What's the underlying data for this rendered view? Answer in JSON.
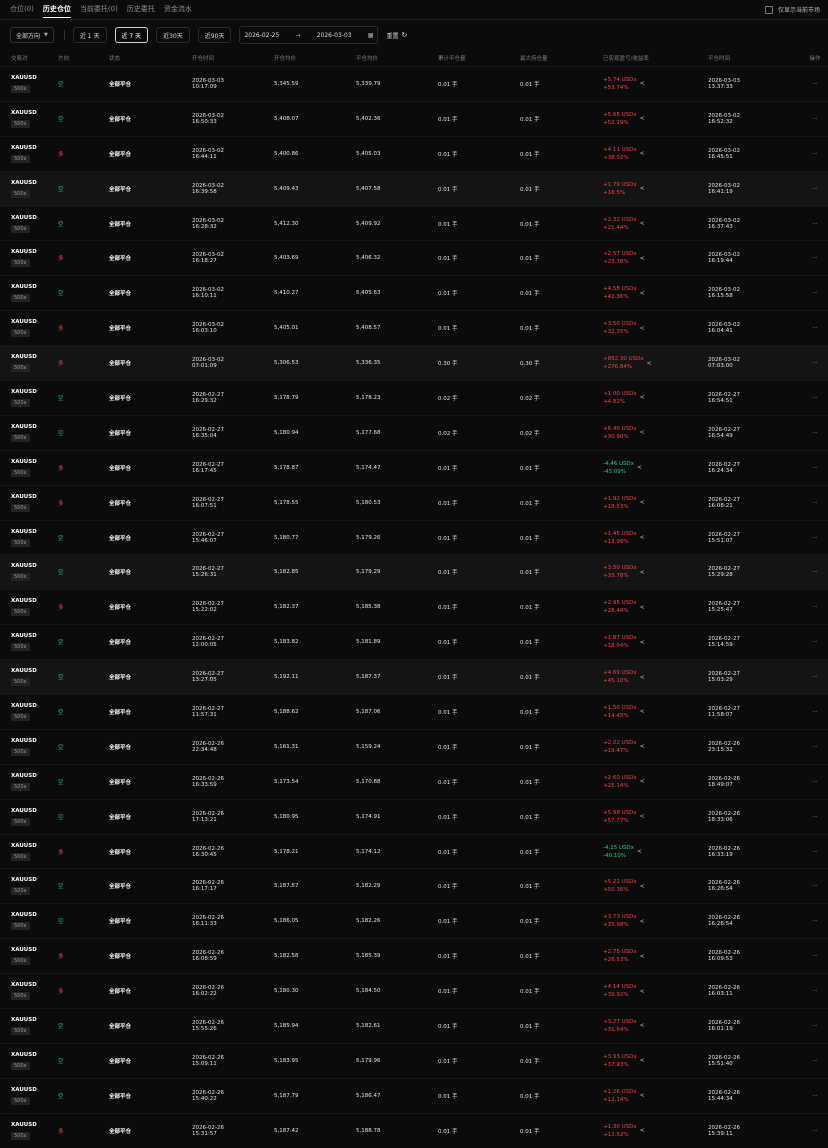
{
  "tabs": [
    {
      "label": "仓位(0)",
      "active": false
    },
    {
      "label": "历史仓位",
      "active": true
    },
    {
      "label": "当前委托(0)",
      "active": false
    },
    {
      "label": "历史委托",
      "active": false
    },
    {
      "label": "资金流水",
      "active": false
    }
  ],
  "market_toggle": {
    "label": "仅显示当前市场",
    "checked": false
  },
  "filters": {
    "direction": "全部方向",
    "periods": [
      {
        "label": "近 1 天",
        "active": false
      },
      {
        "label": "近 7 天",
        "active": true
      },
      {
        "label": "近30天",
        "active": false
      },
      {
        "label": "近90天",
        "active": false
      }
    ],
    "start_date": "2026-02-25",
    "end_date": "2026-03-03",
    "reset": "重置"
  },
  "columns": [
    "交易对",
    "方向",
    "状态",
    "开仓时间",
    "开仓均价",
    "平仓均价",
    "累计平仓量",
    "最大持仓量",
    "已实现盈亏/收益率",
    "平仓时间",
    "操作"
  ],
  "rows": [
    {
      "pair": "XAUUSD",
      "lev": "500x",
      "dir": "空",
      "status": "全部平仓",
      "open_date": "2026-03-03",
      "open_time": "10:17:09",
      "open_price": "5,345.59",
      "close_price": "5,339.79",
      "closed_qty": "0.01 手",
      "max_qty": "0.01 手",
      "pnl": "+5.74 USDx",
      "roi": "+53.74%",
      "close_date": "2026-03-03",
      "close_time": "13:37:33"
    },
    {
      "pair": "XAUUSD",
      "lev": "500x",
      "dir": "空",
      "status": "全部平仓",
      "open_date": "2026-03-02",
      "open_time": "16:50:33",
      "open_price": "5,408.07",
      "close_price": "5,402.36",
      "closed_qty": "0.01 手",
      "max_qty": "0.01 手",
      "pnl": "+5.65 USDx",
      "roi": "+52.29%",
      "close_date": "2026-03-02",
      "close_time": "16:52:32"
    },
    {
      "pair": "XAUUSD",
      "lev": "500x",
      "dir": "多",
      "status": "全部平仓",
      "open_date": "2026-03-02",
      "open_time": "16:44:11",
      "open_price": "5,400.86",
      "close_price": "5,405.03",
      "closed_qty": "0.01 手",
      "max_qty": "0.01 手",
      "pnl": "+4.11 USDx",
      "roi": "+38.02%",
      "close_date": "2026-03-02",
      "close_time": "16:45:51"
    },
    {
      "pair": "XAUUSD",
      "lev": "500x",
      "dir": "空",
      "status": "全部平仓",
      "open_date": "2026-03-02",
      "open_time": "16:39:58",
      "open_price": "5,409.43",
      "close_price": "5,407.58",
      "closed_qty": "0.01 手",
      "max_qty": "0.01 手",
      "pnl": "+1.79 USDx",
      "roi": "+16.5%",
      "close_date": "2026-03-02",
      "close_time": "16:41:19"
    },
    {
      "pair": "XAUUSD",
      "lev": "500x",
      "dir": "空",
      "status": "全部平仓",
      "open_date": "2026-03-02",
      "open_time": "16:28:32",
      "open_price": "5,412.30",
      "close_price": "5,409.92",
      "closed_qty": "0.01 手",
      "max_qty": "0.01 手",
      "pnl": "+2.32 USDx",
      "roi": "+21.44%",
      "close_date": "2026-03-02",
      "close_time": "16:37:43"
    },
    {
      "pair": "XAUUSD",
      "lev": "500x",
      "dir": "多",
      "status": "全部平仓",
      "open_date": "2026-03-02",
      "open_time": "16:18:27",
      "open_price": "5,403.69",
      "close_price": "5,406.32",
      "closed_qty": "0.01 手",
      "max_qty": "0.01 手",
      "pnl": "+2.57 USDx",
      "roi": "+23.76%",
      "close_date": "2026-03-02",
      "close_time": "16:19:44"
    },
    {
      "pair": "XAUUSD",
      "lev": "500x",
      "dir": "空",
      "status": "全部平仓",
      "open_date": "2026-03-02",
      "open_time": "16:10:11",
      "open_price": "5,410.27",
      "close_price": "5,405.63",
      "closed_qty": "0.01 手",
      "max_qty": "0.01 手",
      "pnl": "+4.58 USDx",
      "roi": "+42.36%",
      "close_date": "2026-03-02",
      "close_time": "16:15:58"
    },
    {
      "pair": "XAUUSD",
      "lev": "500x",
      "dir": "多",
      "status": "全部平仓",
      "open_date": "2026-03-02",
      "open_time": "16:03:10",
      "open_price": "5,405.01",
      "close_price": "5,408.57",
      "closed_qty": "0.01 手",
      "max_qty": "0.01 手",
      "pnl": "+3.50 USDx",
      "roi": "+32.35%",
      "close_date": "2026-03-02",
      "close_time": "16:04:41"
    },
    {
      "pair": "XAUUSD",
      "lev": "500x",
      "dir": "多",
      "status": "全部平仓",
      "open_date": "2026-03-02",
      "open_time": "07:01:09",
      "open_price": "5,306.53",
      "close_price": "5,336.35",
      "closed_qty": "0.30 手",
      "max_qty": "0.30 手",
      "pnl": "+892.30 USDx",
      "roi": "+276.84%",
      "close_date": "2026-03-02",
      "close_time": "07:03:00"
    },
    {
      "pair": "XAUUSD",
      "lev": "500x",
      "dir": "空",
      "status": "全部平仓",
      "open_date": "2026-02-27",
      "open_time": "16:29:32",
      "open_price": "5,178.79",
      "close_price": "5,178.23",
      "closed_qty": "0.02 手",
      "max_qty": "0.02 手",
      "pnl": "+1.00 USDx",
      "roi": "+4.82%",
      "close_date": "2026-02-27",
      "close_time": "16:54:51"
    },
    {
      "pair": "XAUUSD",
      "lev": "500x",
      "dir": "空",
      "status": "全部平仓",
      "open_date": "2026-02-27",
      "open_time": "16:35:04",
      "open_price": "5,180.94",
      "close_price": "5,177.68",
      "closed_qty": "0.02 手",
      "max_qty": "0.02 手",
      "pnl": "+6.40 USDx",
      "roi": "+30.90%",
      "close_date": "2026-02-27",
      "close_time": "16:54:49"
    },
    {
      "pair": "XAUUSD",
      "lev": "500x",
      "dir": "多",
      "status": "全部平仓",
      "open_date": "2026-02-27",
      "open_time": "16:17:45",
      "open_price": "5,178.87",
      "close_price": "5,174.47",
      "closed_qty": "0.01 手",
      "max_qty": "0.01 手",
      "pnl": "-4.46 USDx",
      "roi": "-43.09%",
      "close_date": "2026-02-27",
      "close_time": "16:24:34"
    },
    {
      "pair": "XAUUSD",
      "lev": "500x",
      "dir": "多",
      "status": "全部平仓",
      "open_date": "2026-02-27",
      "open_time": "16:07:51",
      "open_price": "5,178.55",
      "close_price": "5,180.53",
      "closed_qty": "0.01 手",
      "max_qty": "0.01 手",
      "pnl": "+1.92 USDx",
      "roi": "+18.53%",
      "close_date": "2026-02-27",
      "close_time": "16:08:21"
    },
    {
      "pair": "XAUUSD",
      "lev": "500x",
      "dir": "空",
      "status": "全部平仓",
      "open_date": "2026-02-27",
      "open_time": "15:46:07",
      "open_price": "5,180.77",
      "close_price": "5,179.26",
      "closed_qty": "0.01 手",
      "max_qty": "0.01 手",
      "pnl": "+1.45 USDx",
      "roi": "+13.99%",
      "close_date": "2026-02-27",
      "close_time": "15:51:07"
    },
    {
      "pair": "XAUUSD",
      "lev": "500x",
      "dir": "空",
      "status": "全部平仓",
      "open_date": "2026-02-27",
      "open_time": "15:26:31",
      "open_price": "5,182.85",
      "close_price": "5,179.29",
      "closed_qty": "0.01 手",
      "max_qty": "0.01 手",
      "pnl": "+3.50 USDx",
      "roi": "+33.78%",
      "close_date": "2026-02-27",
      "close_time": "15:29:28"
    },
    {
      "pair": "XAUUSD",
      "lev": "500x",
      "dir": "多",
      "status": "全部平仓",
      "open_date": "2026-02-27",
      "open_time": "15:22:02",
      "open_price": "5,182.37",
      "close_price": "5,185.38",
      "closed_qty": "0.01 手",
      "max_qty": "0.01 手",
      "pnl": "+2.95 USDx",
      "roi": "+28.44%",
      "close_date": "2026-02-27",
      "close_time": "15:25:47"
    },
    {
      "pair": "XAUUSD",
      "lev": "500x",
      "dir": "空",
      "status": "全部平仓",
      "open_date": "2026-02-27",
      "open_time": "12:00:05",
      "open_price": "5,183.82",
      "close_price": "5,181.89",
      "closed_qty": "0.01 手",
      "max_qty": "0.01 手",
      "pnl": "+1.87 USDx",
      "roi": "+18.04%",
      "close_date": "2026-02-27",
      "close_time": "15:14:59"
    },
    {
      "pair": "XAUUSD",
      "lev": "500x",
      "dir": "空",
      "status": "全部平仓",
      "open_date": "2026-02-27",
      "open_time": "13:27:05",
      "open_price": "5,192.11",
      "close_price": "5,187.37",
      "closed_qty": "0.01 手",
      "max_qty": "0.01 手",
      "pnl": "+4.69 USDx",
      "roi": "+45.10%",
      "close_date": "2026-02-27",
      "close_time": "15:03:29"
    },
    {
      "pair": "XAUUSD",
      "lev": "500x",
      "dir": "空",
      "status": "全部平仓",
      "open_date": "2026-02-27",
      "open_time": "11:57:31",
      "open_price": "5,188.62",
      "close_price": "5,187.06",
      "closed_qty": "0.01 手",
      "max_qty": "0.01 手",
      "pnl": "+1.50 USDx",
      "roi": "+14.45%",
      "close_date": "2026-02-27",
      "close_time": "11:58:07"
    },
    {
      "pair": "XAUUSD",
      "lev": "500x",
      "dir": "空",
      "status": "全部平仓",
      "open_date": "2026-02-26",
      "open_time": "22:34:48",
      "open_price": "5,161.31",
      "close_price": "5,159.24",
      "closed_qty": "0.01 手",
      "max_qty": "0.01 手",
      "pnl": "+2.02 USDx",
      "roi": "+19.47%",
      "close_date": "2026-02-26",
      "close_time": "23:15:32"
    },
    {
      "pair": "XAUUSD",
      "lev": "500x",
      "dir": "空",
      "status": "全部平仓",
      "open_date": "2026-02-26",
      "open_time": "16:33:59",
      "open_price": "5,173.54",
      "close_price": "5,170.88",
      "closed_qty": "0.01 手",
      "max_qty": "0.01 手",
      "pnl": "+2.60 USDx",
      "roi": "+25.14%",
      "close_date": "2026-02-26",
      "close_time": "18:49:07"
    },
    {
      "pair": "XAUUSD",
      "lev": "500x",
      "dir": "空",
      "status": "全部平仓",
      "open_date": "2026-02-26",
      "open_time": "17:13:21",
      "open_price": "5,180.95",
      "close_price": "5,174.91",
      "closed_qty": "0.01 手",
      "max_qty": "0.01 手",
      "pnl": "+5.98 USDx",
      "roi": "+57.77%",
      "close_date": "2026-02-26",
      "close_time": "18:33:06"
    },
    {
      "pair": "XAUUSD",
      "lev": "500x",
      "dir": "多",
      "status": "全部平仓",
      "open_date": "2026-02-26",
      "open_time": "16:30:45",
      "open_price": "5,178.21",
      "close_price": "5,174.12",
      "closed_qty": "0.01 手",
      "max_qty": "0.01 手",
      "pnl": "-4.15 USDx",
      "roi": "-40.10%",
      "close_date": "2026-02-26",
      "close_time": "16:33:19"
    },
    {
      "pair": "XAUUSD",
      "lev": "500x",
      "dir": "空",
      "status": "全部平仓",
      "open_date": "2026-02-26",
      "open_time": "16:17:17",
      "open_price": "5,187.57",
      "close_price": "5,182.29",
      "closed_qty": "0.01 手",
      "max_qty": "0.01 手",
      "pnl": "+5.22 USDx",
      "roi": "+50.36%",
      "close_date": "2026-02-26",
      "close_time": "16:26:54"
    },
    {
      "pair": "XAUUSD",
      "lev": "500x",
      "dir": "空",
      "status": "全部平仓",
      "open_date": "2026-02-26",
      "open_time": "16:11:33",
      "open_price": "5,186.05",
      "close_price": "5,182.26",
      "closed_qty": "0.01 手",
      "max_qty": "0.01 手",
      "pnl": "+3.73 USDx",
      "roi": "+35.98%",
      "close_date": "2026-02-26",
      "close_time": "16:26:54"
    },
    {
      "pair": "XAUUSD",
      "lev": "500x",
      "dir": "多",
      "status": "全部平仓",
      "open_date": "2026-02-26",
      "open_time": "16:08:59",
      "open_price": "5,182.58",
      "close_price": "5,185.39",
      "closed_qty": "0.01 手",
      "max_qty": "0.01 手",
      "pnl": "+2.75 USDx",
      "roi": "+26.53%",
      "close_date": "2026-02-26",
      "close_time": "16:09:53"
    },
    {
      "pair": "XAUUSD",
      "lev": "500x",
      "dir": "多",
      "status": "全部平仓",
      "open_date": "2026-02-26",
      "open_time": "16:02:22",
      "open_price": "5,180.30",
      "close_price": "5,184.50",
      "closed_qty": "0.01 手",
      "max_qty": "0.01 手",
      "pnl": "+4.14 USDx",
      "roi": "+39.92%",
      "close_date": "2026-02-26",
      "close_time": "16:03:11"
    },
    {
      "pair": "XAUUSD",
      "lev": "500x",
      "dir": "空",
      "status": "全部平仓",
      "open_date": "2026-02-26",
      "open_time": "15:55:26",
      "open_price": "5,185.94",
      "close_price": "5,182.61",
      "closed_qty": "0.01 手",
      "max_qty": "0.01 手",
      "pnl": "+3.27 USDx",
      "roi": "+31.54%",
      "close_date": "2026-02-26",
      "close_time": "16:01:19"
    },
    {
      "pair": "XAUUSD",
      "lev": "500x",
      "dir": "空",
      "status": "全部平仓",
      "open_date": "2026-02-26",
      "open_time": "15:09:11",
      "open_price": "5,183.95",
      "close_price": "5,179.96",
      "closed_qty": "0.01 手",
      "max_qty": "0.01 手",
      "pnl": "+3.93 USDx",
      "roi": "+37.93%",
      "close_date": "2026-02-26",
      "close_time": "15:51:40"
    },
    {
      "pair": "XAUUSD",
      "lev": "500x",
      "dir": "空",
      "status": "全部平仓",
      "open_date": "2026-02-26",
      "open_time": "15:40:22",
      "open_price": "5,187.79",
      "close_price": "5,186.47",
      "closed_qty": "0.01 手",
      "max_qty": "0.01 手",
      "pnl": "+1.26 USDx",
      "roi": "+12.14%",
      "close_date": "2026-02-26",
      "close_time": "15:44:34"
    },
    {
      "pair": "XAUUSD",
      "lev": "500x",
      "dir": "多",
      "status": "全部平仓",
      "open_date": "2026-02-26",
      "open_time": "15:31:57",
      "open_price": "5,187.42",
      "close_price": "5,188.78",
      "closed_qty": "0.01 手",
      "max_qty": "0.01 手",
      "pnl": "+1.30 USDx",
      "roi": "+12.52%",
      "close_date": "2026-02-26",
      "close_time": "15:39:11"
    }
  ],
  "action_glyph": "···",
  "icons": {
    "share": "share-icon",
    "calendar": "calendar-icon",
    "refresh": "refresh-icon",
    "arrow": "arrow-right-icon",
    "dropdown": "caret-down-icon"
  },
  "colors": {
    "long": "#f0434b",
    "short": "#1fb88a",
    "profit": "#f0434b",
    "loss": "#1fcf8a",
    "background": "#0b0b0b"
  }
}
